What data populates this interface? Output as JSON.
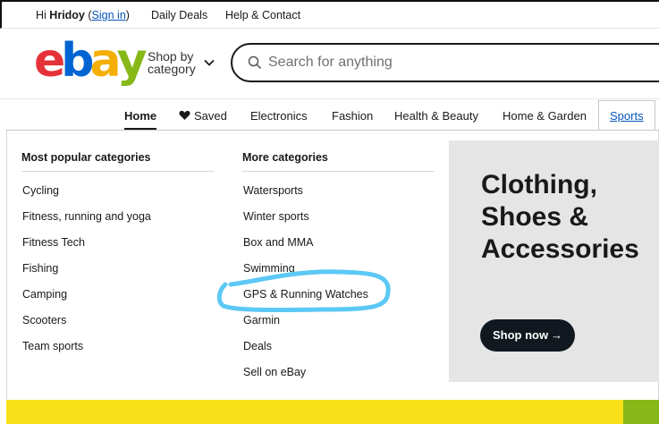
{
  "topbar": {
    "greeting_prefix": "Hi",
    "user_name": "Hridoy",
    "open_paren": "(",
    "sign_in": "Sign in",
    "close_paren": ")",
    "daily_deals": "Daily Deals",
    "help_contact": "Help & Contact"
  },
  "header": {
    "logo_letters": [
      "e",
      "b",
      "a",
      "y"
    ],
    "logo_colors": [
      "#e53238",
      "#0064d2",
      "#f5af02",
      "#86b817"
    ],
    "shop_by_line1": "Shop by",
    "shop_by_line2": "category",
    "search_placeholder": "Search for anything"
  },
  "nav": {
    "items": [
      "Home",
      "Saved",
      "Electronics",
      "Fashion",
      "Health & Beauty",
      "Home & Garden",
      "Sports"
    ],
    "active": "Home",
    "hovered": "Sports"
  },
  "dropdown": {
    "popular_title": "Most popular categories",
    "popular": [
      "Cycling",
      "Fitness, running and yoga",
      "Fitness Tech",
      "Fishing",
      "Camping",
      "Scooters",
      "Team sports"
    ],
    "more_title": "More categories",
    "more": [
      "Watersports",
      "Winter sports",
      "Box and MMA",
      "Swimming",
      "GPS & Running Watches",
      "Garmin",
      "Deals",
      "Sell on eBay"
    ],
    "highlighted_item": "GPS & Running Watches",
    "promo": {
      "line1": "Clothing,",
      "line2": "Shoes &",
      "line3": "Accessories",
      "cta": "Shop now"
    }
  },
  "colors": {
    "link_blue": "#0654ba",
    "highlight_cyan": "#5bc8f5",
    "promo_bg": "#e5e5e5",
    "cta_bg": "#111820",
    "banner_yellow": "#f7e017",
    "banner_green": "#86b817"
  }
}
